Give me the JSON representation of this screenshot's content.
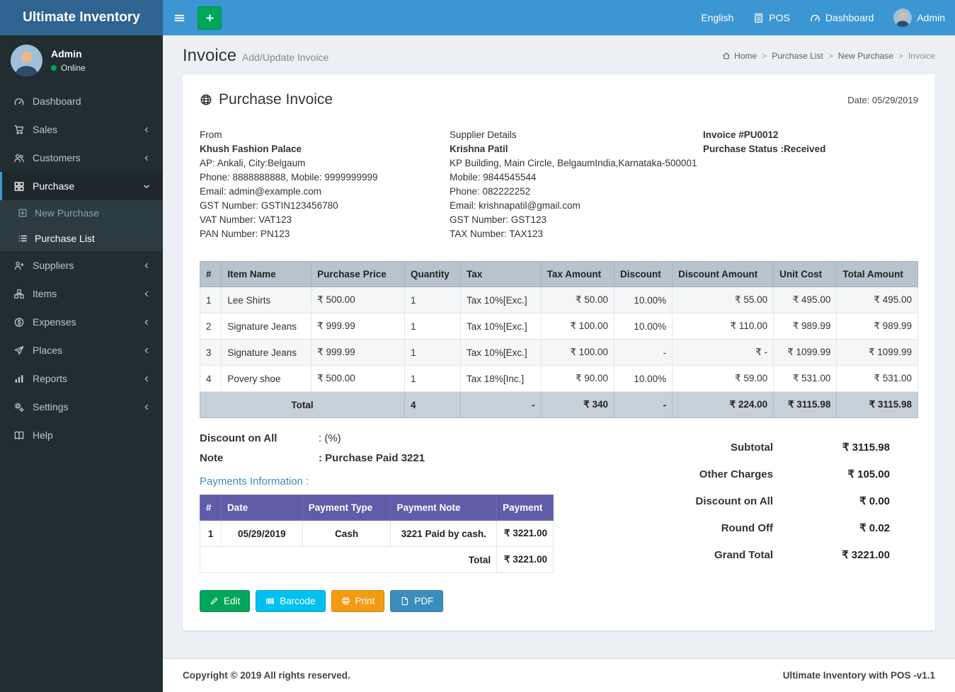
{
  "brand": "Ultimate Inventory",
  "colors": {
    "navbar": "#3c96d2",
    "logo_bg": "#2f6390",
    "sidebar_bg": "#222d32",
    "accent": "#3c8dbc",
    "success": "#00a65a",
    "info": "#00c0ef",
    "warning": "#f39c12",
    "payments_header": "#605ca8"
  },
  "topbar": {
    "language": "English",
    "pos": "POS",
    "dashboard": "Dashboard",
    "user": "Admin"
  },
  "sidebar": {
    "user": {
      "name": "Admin",
      "status": "Online"
    },
    "items": [
      "Dashboard",
      "Sales",
      "Customers",
      "Purchase",
      "Suppliers",
      "Items",
      "Expenses",
      "Places",
      "Reports",
      "Settings",
      "Help"
    ],
    "purchase_children": [
      "New Purchase",
      "Purchase List"
    ]
  },
  "page": {
    "title": "Invoice",
    "subtitle": "Add/Update Invoice",
    "breadcrumb": [
      "Home",
      "Purchase List",
      "New Purchase",
      "Invoice"
    ]
  },
  "invoice": {
    "card_title": "Purchase Invoice",
    "date": "Date: 05/29/2019",
    "from": {
      "heading": "From",
      "name": "Khush Fashion Palace",
      "lines": [
        "AP: Ankali, City:Belgaum",
        "Phone: 8888888888, Mobile: 9999999999",
        "Email: admin@example.com",
        "GST Number: GSTIN123456780",
        "VAT Number: VAT123",
        "PAN Number: PN123"
      ]
    },
    "supplier": {
      "heading": "Supplier Details",
      "name": "Krishna Patil",
      "lines": [
        "KP Building, Main Circle, BelgaumIndia,Karnataka-500001",
        "Mobile: 9844545544",
        "Phone: 082222252",
        "Email: krishnapatil@gmail.com",
        "GST Number: GST123",
        "TAX Number: TAX123"
      ]
    },
    "meta": {
      "invoice_no": "Invoice #PU0012",
      "status": "Purchase Status :Received"
    }
  },
  "items_table": {
    "headers": [
      "#",
      "Item Name",
      "Purchase Price",
      "Quantity",
      "Tax",
      "Tax Amount",
      "Discount",
      "Discount Amount",
      "Unit Cost",
      "Total Amount"
    ],
    "rows": [
      [
        "1",
        "Lee Shirts",
        "₹ 500.00",
        "1",
        "Tax 10%[Exc.]",
        "₹ 50.00",
        "10.00%",
        "₹ 55.00",
        "₹ 495.00",
        "₹ 495.00"
      ],
      [
        "2",
        "Signature Jeans",
        "₹ 999.99",
        "1",
        "Tax 10%[Exc.]",
        "₹ 100.00",
        "10.00%",
        "₹ 110.00",
        "₹ 989.99",
        "₹ 989.99"
      ],
      [
        "3",
        "Signature Jeans",
        "₹ 999.99",
        "1",
        "Tax 10%[Exc.]",
        "₹ 100.00",
        "-",
        "₹ -",
        "₹ 1099.99",
        "₹ 1099.99"
      ],
      [
        "4",
        "Povery shoe",
        "₹ 500.00",
        "1",
        "Tax 18%[Inc.]",
        "₹ 90.00",
        "10.00%",
        "₹ 59.00",
        "₹ 531.00",
        "₹ 531.00"
      ]
    ],
    "total_row": {
      "label": "Total",
      "quantity": "4",
      "tax": "-",
      "tax_amount": "₹ 340",
      "discount": "-",
      "discount_amount": "₹ 224.00",
      "unit_cost": "₹ 3115.98",
      "total_amount": "₹ 3115.98"
    }
  },
  "notes": {
    "discount_label": "Discount on All",
    "discount_value": ": (%)",
    "note_label": "Note",
    "note_value": ": Purchase Paid 3221"
  },
  "payments": {
    "heading": "Payments Information :",
    "headers": [
      "#",
      "Date",
      "Payment Type",
      "Payment Note",
      "Payment"
    ],
    "rows": [
      [
        "1",
        "05/29/2019",
        "Cash",
        "3221 Paid by cash.",
        "₹ 3221.00"
      ]
    ],
    "total_label": "Total",
    "total_value": "₹ 3221.00"
  },
  "summary": {
    "rows": [
      {
        "label": "Subtotal",
        "value": "₹ 3115.98"
      },
      {
        "label": "Other Charges",
        "value": "₹ 105.00"
      },
      {
        "label": "Discount on All",
        "value": "₹ 0.00"
      },
      {
        "label": "Round Off",
        "value": "₹ 0.02"
      },
      {
        "label": "Grand Total",
        "value": "₹ 3221.00"
      }
    ]
  },
  "actions": {
    "edit": "Edit",
    "barcode": "Barcode",
    "print": "Print",
    "pdf": "PDF"
  },
  "footer": {
    "left": "Copyright © 2019 All rights reserved.",
    "right": "Ultimate Inventory with POS -v1.1"
  }
}
